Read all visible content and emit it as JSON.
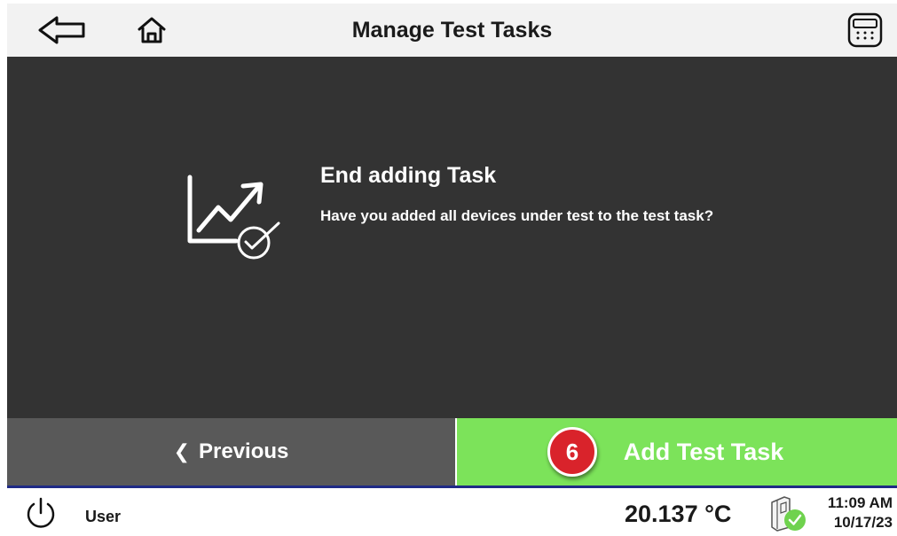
{
  "header": {
    "title": "Manage Test Tasks",
    "back_icon": "arrow-left-outline",
    "home_icon": "home",
    "keypad_icon": "keypad"
  },
  "dialog": {
    "icon": "chart-with-check",
    "title": "End adding Task",
    "message": "Have you added all devices under test to the test task?"
  },
  "buttons": {
    "previous": {
      "chevron": "❮",
      "label": "Previous"
    },
    "add": {
      "step_number": "6",
      "label": "Add Test Task"
    }
  },
  "status_bar": {
    "user": "User",
    "temperature": "20.137 °C",
    "device_status_icon": "device-ok",
    "time": "11:09 AM",
    "date": "10/17/23"
  },
  "colors": {
    "header_bg": "#f2f2f2",
    "content_bg": "#333333",
    "previous_bg": "#595959",
    "add_bg": "#7ce35a",
    "badge": "#d9232b",
    "status_line": "#1f2a85",
    "ok_green": "#6fd24e"
  }
}
